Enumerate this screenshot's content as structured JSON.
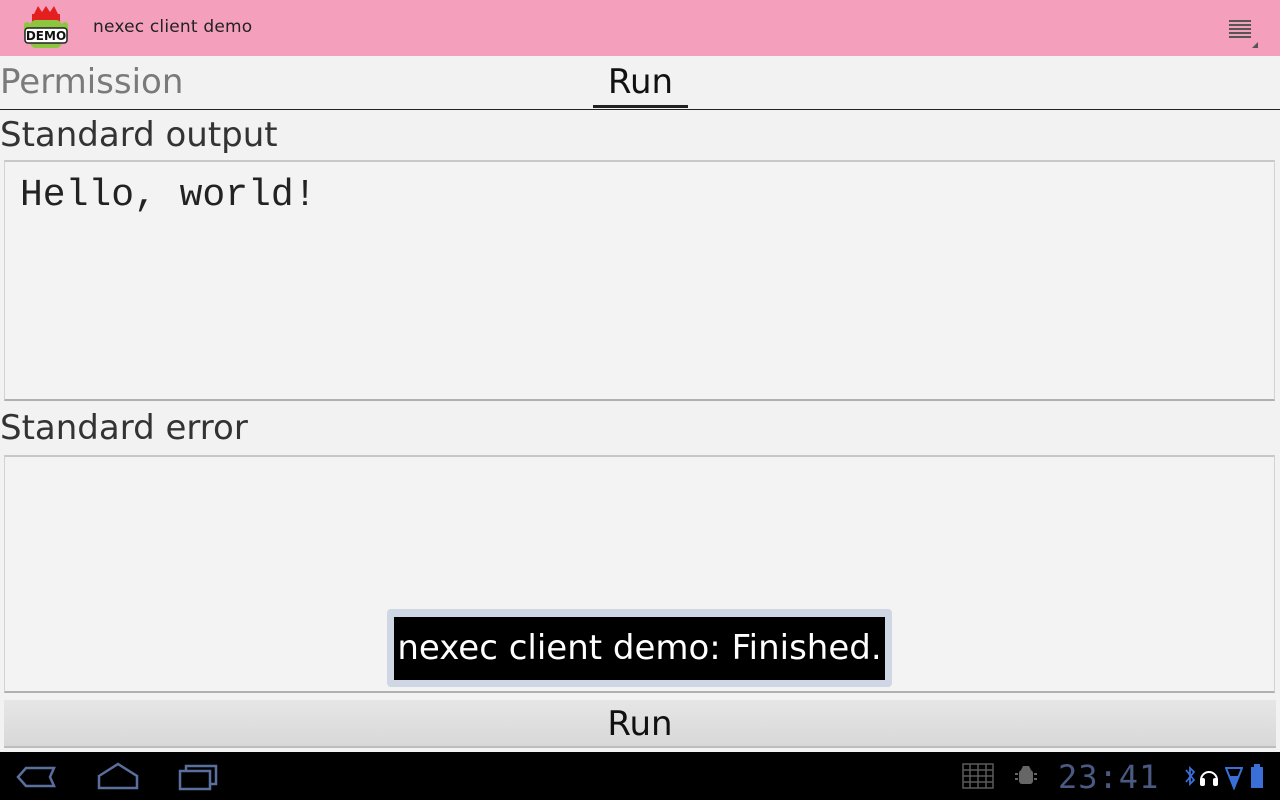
{
  "app": {
    "title": "nexec client demo",
    "icon_label": "DEMO"
  },
  "tabs": [
    {
      "label": "Permission",
      "selected": false
    },
    {
      "label": "Run",
      "selected": true
    }
  ],
  "sections": {
    "stdout_label": "Standard output",
    "stdout_value": "Hello, world!",
    "stderr_label": "Standard error",
    "stderr_value": ""
  },
  "run_button_label": "Run",
  "toast": "nexec client demo: Finished.",
  "system_bar": {
    "clock": "23:41",
    "icons": [
      "back-icon",
      "home-icon",
      "recent-apps-icon",
      "keyboard-grid-icon",
      "android-debug-icon",
      "bluetooth-icon",
      "headset-icon",
      "wifi-icon",
      "battery-icon"
    ]
  },
  "colors": {
    "action_bar": "#f4a0bc",
    "background": "#f2f2f2",
    "system_bar": "#000000",
    "clock": "#4a5a82"
  }
}
